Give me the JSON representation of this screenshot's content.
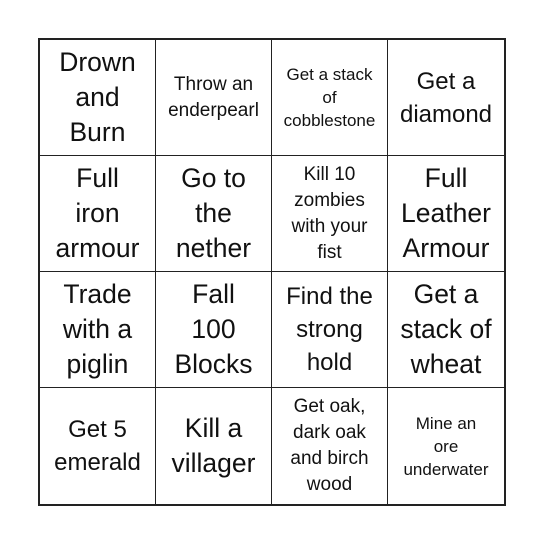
{
  "cells": [
    {
      "text": "Drown\nand\nBurn"
    },
    {
      "text": "Throw an\nenderpearl"
    },
    {
      "text": "Get a stack\nof\ncobblestone"
    },
    {
      "text": "Get a\ndiamond"
    },
    {
      "text": "Full\niron\narmour"
    },
    {
      "text": "Go to\nthe\nnether"
    },
    {
      "text": "Kill 10\nzombies\nwith your\nfist"
    },
    {
      "text": "Full\nLeather\nArmour"
    },
    {
      "text": "Trade\nwith a\npiglin"
    },
    {
      "text": "Fall\n100\nBlocks"
    },
    {
      "text": "Find the\nstrong\nhold"
    },
    {
      "text": "Get a\nstack of\nwheat"
    },
    {
      "text": "Get 5\nemerald"
    },
    {
      "text": "Kill a\nvillager"
    },
    {
      "text": "Get oak,\ndark oak\nand birch\nwood"
    },
    {
      "text": "Mine an\nore\nunderwater"
    }
  ]
}
